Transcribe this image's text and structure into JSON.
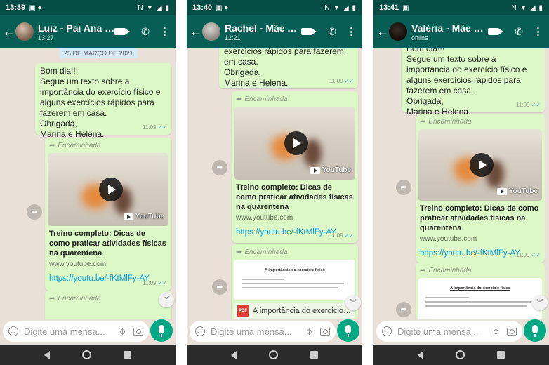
{
  "colors": {
    "appbar": "#075e54",
    "statusbar": "#054d44",
    "outgoing_bubble": "#dcf8c6",
    "chat_background": "#e9e1d7",
    "link": "#039be5",
    "read_ticks": "#4fb6ec",
    "mic_button": "#00a884"
  },
  "icons": [
    "back-arrow-icon",
    "video-call-icon",
    "phone-icon",
    "more-menu-icon",
    "forward-icon",
    "share-icon",
    "play-icon",
    "youtube-icon",
    "pdf-icon",
    "emoji-icon",
    "attach-icon",
    "camera-icon",
    "mic-icon",
    "scroll-down-icon",
    "nav-back-icon",
    "nav-home-icon",
    "nav-recent-icon"
  ],
  "screens": [
    {
      "status_time": "13:39",
      "status_icons": "N ▼ ◢ ▮",
      "contact_name": "Luiz - Pai Ana Cri...",
      "contact_sub": "13:27",
      "date_chip": "25 DE MARÇO DE 2021",
      "text_message": "Bom dia!!!\nSegue um texto sobre a importância do exercício físico e alguns exercícios rápidos para fazerem em casa.\nObrigada,\nMarina e Helena.",
      "text_time": "11:09",
      "forwarded_label": "Encaminhada",
      "youtube_label": "YouTube",
      "link_title": "Treino completo: Dicas de como praticar atividades físicas na quarentena",
      "link_domain": "www.youtube.com",
      "link_url": "https://youtu.be/-fKtMlFy-AY",
      "link_time": "11:09",
      "forwarded_label_2": "Encaminhada",
      "input_placeholder": "Digite uma mensa..."
    },
    {
      "status_time": "13:40",
      "status_icons": "N ▼ ◢ ▮",
      "contact_name": "Rachel - Mãe Ana...",
      "contact_sub": "12:21",
      "text_message": "exercícios rápidos para fazerem em casa.\nObrigada,\nMarina e Helena.",
      "text_time": "11:09",
      "forwarded_label": "Encaminhada",
      "youtube_label": "YouTube",
      "link_title": "Treino completo: Dicas de como praticar atividades físicas na quarentena",
      "link_domain": "www.youtube.com",
      "link_url": "https://youtu.be/-fKtMlFy-AY",
      "link_time": "11:09",
      "forwarded_label_2": "Encaminhada",
      "doc_heading": "A importância do exercício físico",
      "doc_name": "A importância do exercício f...",
      "input_placeholder": "Digite uma mensa..."
    },
    {
      "status_time": "13:41",
      "status_icons": "N ▼ ◢ ▮",
      "contact_name": "Valéria - Mãe Ellen",
      "contact_sub": "online",
      "text_message": "Bom dia!!!\nSegue um texto sobre a importância do exercício físico e alguns exercícios rápidos para fazerem em casa.\nObrigada,\nMarina e Helena.",
      "text_time": "11:09",
      "forwarded_label": "Encaminhada",
      "youtube_label": "YouTube",
      "link_title": "Treino completo: Dicas de como praticar atividades físicas na quarentena",
      "link_domain": "www.youtube.com",
      "link_url": "https://youtu.be/-fKtMlFy-AY",
      "link_time": "11:09",
      "forwarded_label_2": "Encaminhada",
      "doc_heading": "A importância do exercício físico",
      "input_placeholder": "Digite uma mensa..."
    }
  ]
}
